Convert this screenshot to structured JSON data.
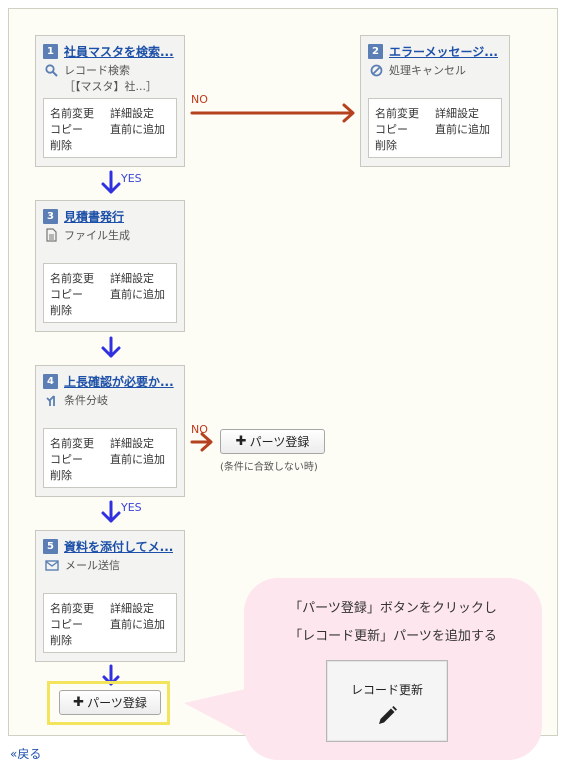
{
  "nodes": [
    {
      "num": "1",
      "title": "社員マスタを検索...",
      "type": "レコード検索",
      "detail": "［【マスタ】社...］",
      "icon": "search-icon"
    },
    {
      "num": "2",
      "title": "エラーメッセージ...",
      "type": "処理キャンセル",
      "detail": "",
      "icon": "cancel-icon"
    },
    {
      "num": "3",
      "title": "見積書発行",
      "type": "ファイル生成",
      "detail": "",
      "icon": "file-icon"
    },
    {
      "num": "4",
      "title": "上長確認が必要か...",
      "type": "条件分岐",
      "detail": "",
      "icon": "branch-icon"
    },
    {
      "num": "5",
      "title": "資料を添付してメ...",
      "type": "メール送信",
      "detail": "",
      "icon": "mail-icon"
    }
  ],
  "actions": {
    "rename": "名前変更",
    "details": "詳細設定",
    "copy": "コピー",
    "insert_before": "直前に追加",
    "delete": "削除"
  },
  "labels": {
    "no": "NO",
    "yes": "YES"
  },
  "branch": {
    "button": "パーツ登録",
    "note": "(条件に合致しない時)"
  },
  "add_parts_button": "パーツ登録",
  "tooltip": {
    "line1": "「パーツ登録」ボタンをクリックし",
    "line2": "「レコード更新」パーツを追加する",
    "button_label": "レコード更新",
    "button_icon": "pencil-icon"
  },
  "back_link": "«戻る",
  "colors": {
    "no_arrow": "#b5411e",
    "yes_arrow": "#3030e0",
    "accent": "#5b7fb5",
    "highlight": "#f2e45c",
    "bubble": "#fde6ee"
  }
}
